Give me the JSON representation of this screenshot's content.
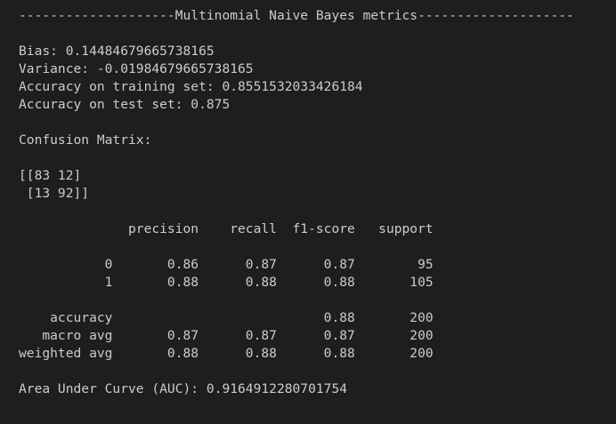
{
  "output": {
    "header": "--------------------Multinomial Naive Bayes metrics--------------------",
    "bias": "Bias: 0.14484679665738165",
    "variance": "Variance: -0.01984679665738165",
    "train_accuracy": "Accuracy on training set: 0.8551532033426184",
    "test_accuracy": "Accuracy on test set: 0.875",
    "confusion_title": "Confusion Matrix:",
    "matrix_row1": "[[83 12]",
    "matrix_row2": " [13 92]]",
    "report_header": "              precision    recall  f1-score   support",
    "report_row_0": "           0       0.86      0.87      0.87        95",
    "report_row_1": "           1       0.88      0.88      0.88       105",
    "report_accuracy": "    accuracy                           0.88       200",
    "report_macro": "   macro avg       0.87      0.87      0.87       200",
    "report_weighted": "weighted avg       0.88      0.88      0.88       200",
    "auc": "Area Under Curve (AUC): 0.9164912280701754"
  }
}
